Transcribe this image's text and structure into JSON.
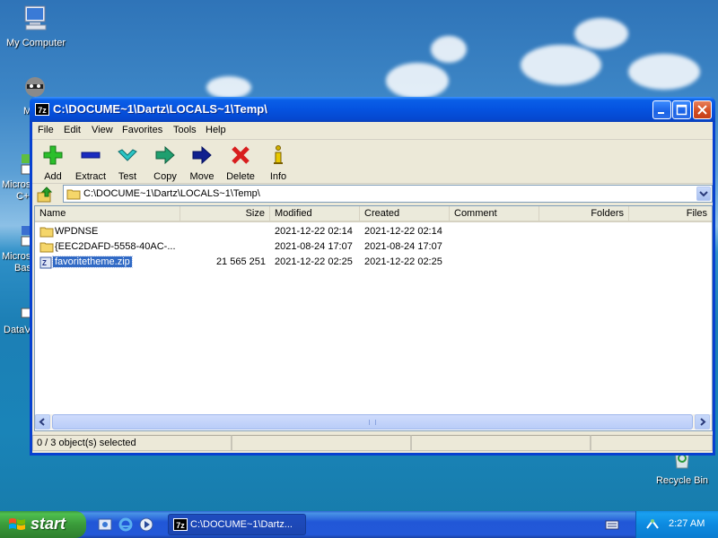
{
  "desktop": {
    "icons": [
      {
        "label": "My Computer"
      },
      {
        "label": "Recycle Bin"
      }
    ],
    "partial_labels": [
      "M",
      "Micros",
      "C+",
      "Micros",
      "Bas",
      "DataV"
    ]
  },
  "window": {
    "title": "C:\\DOCUME~1\\Dartz\\LOCALS~1\\Temp\\",
    "app_icon_text": "7z",
    "menu": [
      "File",
      "Edit",
      "View",
      "Favorites",
      "Tools",
      "Help"
    ],
    "toolbar": [
      {
        "label": "Add",
        "icon": "add-plus-icon",
        "color": "#2bbf2b"
      },
      {
        "label": "Extract",
        "icon": "extract-minus-icon",
        "color": "#1a2bbf"
      },
      {
        "label": "Test",
        "icon": "test-check-icon",
        "color": "#2bb5b5"
      },
      {
        "label": "Copy",
        "icon": "copy-arrow-icon",
        "color": "#1f8f5f"
      },
      {
        "label": "Move",
        "icon": "move-arrow-icon",
        "color": "#10207f"
      },
      {
        "label": "Delete",
        "icon": "delete-x-icon",
        "color": "#d81e1e"
      },
      {
        "label": "Info",
        "icon": "info-icon",
        "color": "#c8a800"
      }
    ],
    "address": "C:\\DOCUME~1\\Dartz\\LOCALS~1\\Temp\\",
    "columns": [
      "Name",
      "Size",
      "Modified",
      "Created",
      "Comment",
      "Folders",
      "Files"
    ],
    "rows": [
      {
        "name": "WPDNSE",
        "size": "",
        "modified": "2021-12-22 02:14",
        "created": "2021-12-22 02:14",
        "type": "folder"
      },
      {
        "name": "{EEC2DAFD-5558-40AC-...",
        "size": "",
        "modified": "2021-08-24 17:07",
        "created": "2021-08-24 17:07",
        "type": "folder"
      },
      {
        "name": "favoritetheme.zip",
        "size": "21 565 251",
        "modified": "2021-12-22 02:25",
        "created": "2021-12-22 02:25",
        "type": "zip"
      }
    ],
    "status": "0 / 3 object(s) selected"
  },
  "taskbar": {
    "start_label": "start",
    "task_label": "C:\\DOCUME~1\\Dartz...",
    "task_icon_text": "7z",
    "clock": "2:27 AM"
  }
}
